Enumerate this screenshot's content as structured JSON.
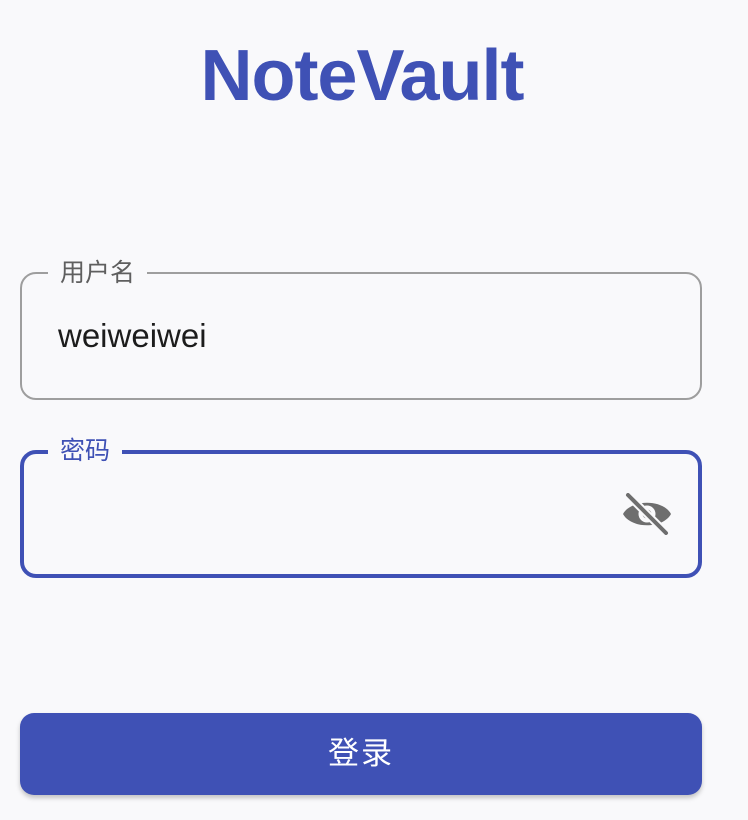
{
  "app": {
    "title": "NoteVault"
  },
  "login_form": {
    "username": {
      "label": "用户名",
      "value": "weiweiwei"
    },
    "password": {
      "label": "密码",
      "value": "",
      "visibility_icon": "eye-off-icon"
    },
    "submit_label": "登录"
  },
  "colors": {
    "primary": "#3f51b5",
    "background": "#f9f9fb",
    "outline_inactive": "#9e9e9e",
    "label_inactive": "#5f5f5f",
    "icon": "#6e6e6e"
  }
}
